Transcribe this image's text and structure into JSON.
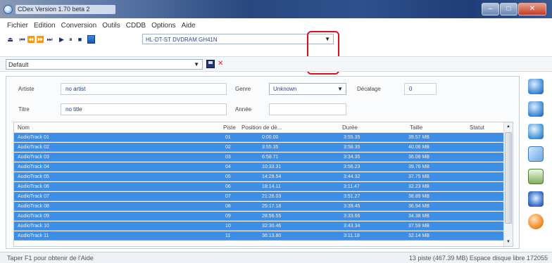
{
  "window": {
    "title": "CDex Version 1.70 beta 2"
  },
  "menu": [
    "Fichier",
    "Edition",
    "Conversion",
    "Outils",
    "CDDB",
    "Options",
    "Aide"
  ],
  "toolbar": {
    "drive": "HL-DT-ST DVDRAM GH41N"
  },
  "profile": {
    "value": "Default"
  },
  "metadata": {
    "artist_label": "Artiste",
    "artist_value": "no artist",
    "title_label": "Titre",
    "title_value": "no title",
    "genre_label": "Genre",
    "genre_value": "Unknown",
    "year_label": "Année",
    "year_value": "",
    "offset_label": "Décalage",
    "offset_value": "0"
  },
  "table": {
    "columns": [
      "Nom",
      "Piste",
      "Position de dé...",
      "Durée",
      "Taille",
      "Statut"
    ],
    "rows": [
      {
        "name": "AudioTrack 01",
        "track": "01",
        "start": "0:00.00",
        "duration": "3:55.35",
        "size": "39.57 MB"
      },
      {
        "name": "AudioTrack 02",
        "track": "02",
        "start": "3:55.35",
        "duration": "3:58.35",
        "size": "40.06 MB"
      },
      {
        "name": "AudioTrack 03",
        "track": "03",
        "start": "6:58.71",
        "duration": "3:34.35",
        "size": "36.08 MB"
      },
      {
        "name": "AudioTrack 04",
        "track": "04",
        "start": "10:33.31",
        "duration": "3:56.23",
        "size": "39.76 MB"
      },
      {
        "name": "AudioTrack 05",
        "track": "05",
        "start": "14:29.54",
        "duration": "3:44.32",
        "size": "37.75 MB"
      },
      {
        "name": "AudioTrack 06",
        "track": "06",
        "start": "18:14.11",
        "duration": "3:11.47",
        "size": "32.23 MB"
      },
      {
        "name": "AudioTrack 07",
        "track": "07",
        "start": "21:26.03",
        "duration": "3:51.27",
        "size": "38.89 MB"
      },
      {
        "name": "AudioTrack 08",
        "track": "08",
        "start": "25:17.18",
        "duration": "3:39.45",
        "size": "36.94 MB"
      },
      {
        "name": "AudioTrack 09",
        "track": "09",
        "start": "28:56.55",
        "duration": "3:33.66",
        "size": "34.38 MB"
      },
      {
        "name": "AudioTrack 10",
        "track": "10",
        "start": "32:30.46",
        "duration": "3:43.34",
        "size": "37.59 MB"
      },
      {
        "name": "AudioTrack 11",
        "track": "11",
        "start": "36:13.80",
        "duration": "3:11.18",
        "size": "32.14 MB"
      }
    ]
  },
  "status": {
    "left": "Taper F1 pour obtenir de l'Aide",
    "right": "13 piste (467.39 MB) Espace disque libre 172055"
  },
  "side_icons": [
    "globe-refresh-icon",
    "globe-refresh-icon",
    "globe-settings-icon",
    "grid-icon",
    "monitor-icon",
    "music-notes-icon",
    "help-icon"
  ],
  "colors": {
    "selection": "#3d8ee6",
    "highlight": "#e0101a"
  }
}
